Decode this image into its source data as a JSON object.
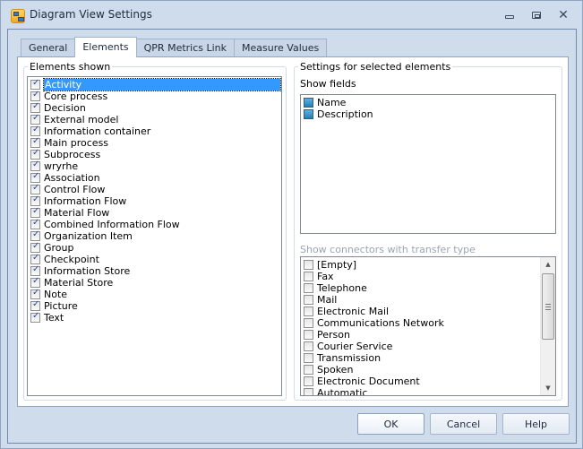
{
  "window": {
    "title": "Diagram View Settings",
    "controls": {
      "minimize": "minimize",
      "maximize": "maximize",
      "close": "close"
    }
  },
  "tabs": [
    {
      "label": "General",
      "active": false
    },
    {
      "label": "Elements",
      "active": true
    },
    {
      "label": "QPR Metrics Link",
      "active": false
    },
    {
      "label": "Measure Values",
      "active": false
    }
  ],
  "elements_shown": {
    "legend": "Elements shown",
    "items": [
      {
        "label": "Activity",
        "checked": true,
        "selected": true
      },
      {
        "label": "Core process",
        "checked": true
      },
      {
        "label": "Decision",
        "checked": true
      },
      {
        "label": "External model",
        "checked": true
      },
      {
        "label": "Information container",
        "checked": true
      },
      {
        "label": "Main process",
        "checked": true
      },
      {
        "label": "Subprocess",
        "checked": true
      },
      {
        "label": "wryrhe",
        "checked": true
      },
      {
        "label": "Association",
        "checked": true
      },
      {
        "label": "Control Flow",
        "checked": true
      },
      {
        "label": "Information Flow",
        "checked": true
      },
      {
        "label": "Material Flow",
        "checked": true
      },
      {
        "label": "Combined Information Flow",
        "checked": true
      },
      {
        "label": "Organization Item",
        "checked": true
      },
      {
        "label": "Group",
        "checked": true
      },
      {
        "label": "Checkpoint",
        "checked": true
      },
      {
        "label": "Information Store",
        "checked": true
      },
      {
        "label": "Material Store",
        "checked": true
      },
      {
        "label": "Note",
        "checked": true
      },
      {
        "label": "Picture",
        "checked": true
      },
      {
        "label": "Text",
        "checked": true
      }
    ]
  },
  "settings": {
    "legend": "Settings for selected elements",
    "show_fields_label": "Show fields",
    "fields": [
      {
        "label": "Name",
        "state": "indeterminate"
      },
      {
        "label": "Description",
        "state": "indeterminate"
      }
    ],
    "connectors_label": "Show connectors with transfer type",
    "connectors": [
      {
        "label": "[Empty]",
        "checked": false
      },
      {
        "label": "Fax",
        "checked": false
      },
      {
        "label": "Telephone",
        "checked": false
      },
      {
        "label": "Mail",
        "checked": false
      },
      {
        "label": "Electronic Mail",
        "checked": false
      },
      {
        "label": "Communications Network",
        "checked": false
      },
      {
        "label": "Person",
        "checked": false
      },
      {
        "label": "Courier Service",
        "checked": false
      },
      {
        "label": "Transmission",
        "checked": false
      },
      {
        "label": "Spoken",
        "checked": false
      },
      {
        "label": "Electronic Document",
        "checked": false
      },
      {
        "label": "Automatic",
        "checked": false
      }
    ]
  },
  "buttons": {
    "ok": "OK",
    "cancel": "Cancel",
    "help": "Help"
  }
}
